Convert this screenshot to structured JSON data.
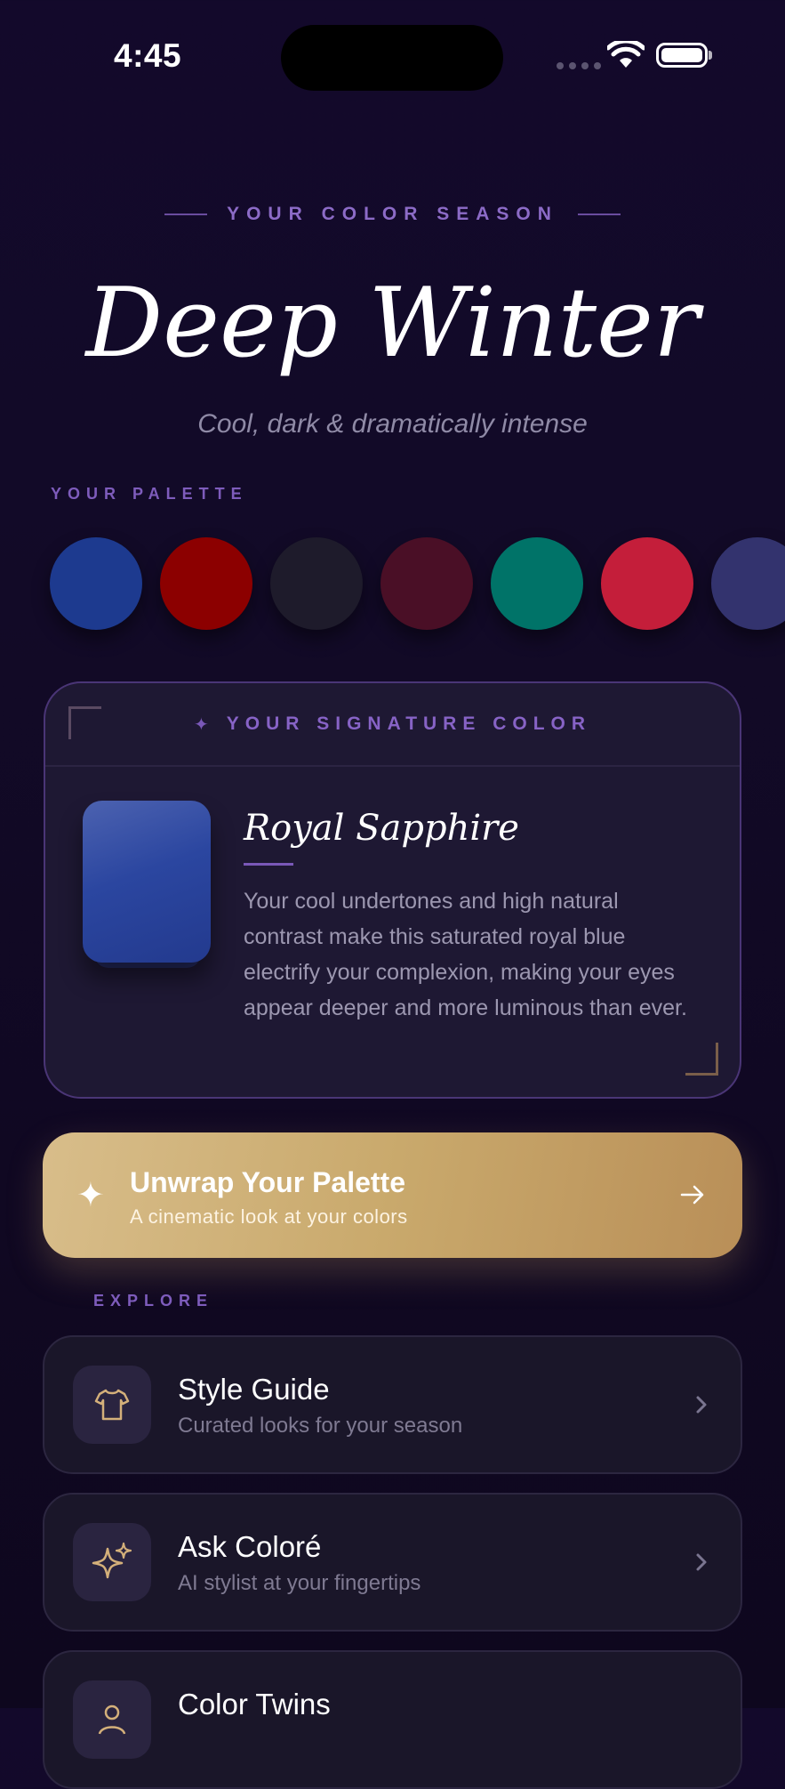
{
  "status_bar": {
    "time": "4:45"
  },
  "header": {
    "season_label": "YOUR COLOR SEASON",
    "season_name": "Deep Winter",
    "season_tagline": "Cool, dark & dramatically intense"
  },
  "palette": {
    "label": "YOUR PALETTE",
    "colors": [
      "#1d3a8f",
      "#8c0000",
      "#1e1b2b",
      "#4a0f26",
      "#007368",
      "#c41e3a",
      "#33336e"
    ]
  },
  "signature": {
    "label": "YOUR SIGNATURE COLOR",
    "name": "Royal Sapphire",
    "color": "#2b46a0",
    "description": "Your cool undertones and high natural contrast make this saturated royal blue electrify your complexion, making your eyes appear deeper and more luminous than ever."
  },
  "cta": {
    "title": "Unwrap Your Palette",
    "subtitle": "A cinematic look at your colors",
    "icon": "sparkle-icon"
  },
  "explore": {
    "label": "EXPLORE",
    "items": [
      {
        "title": "Style Guide",
        "subtitle": "Curated looks for your season",
        "icon": "tshirt-icon"
      },
      {
        "title": "Ask Coloré",
        "subtitle": "AI stylist at your fingertips",
        "icon": "sparkles-icon"
      },
      {
        "title": "Color Twins",
        "subtitle": "",
        "icon": "person-icon"
      }
    ]
  },
  "colors": {
    "accent_purple": "#8c6bc7",
    "gold": "#c9a96c",
    "background": "#120a27"
  }
}
